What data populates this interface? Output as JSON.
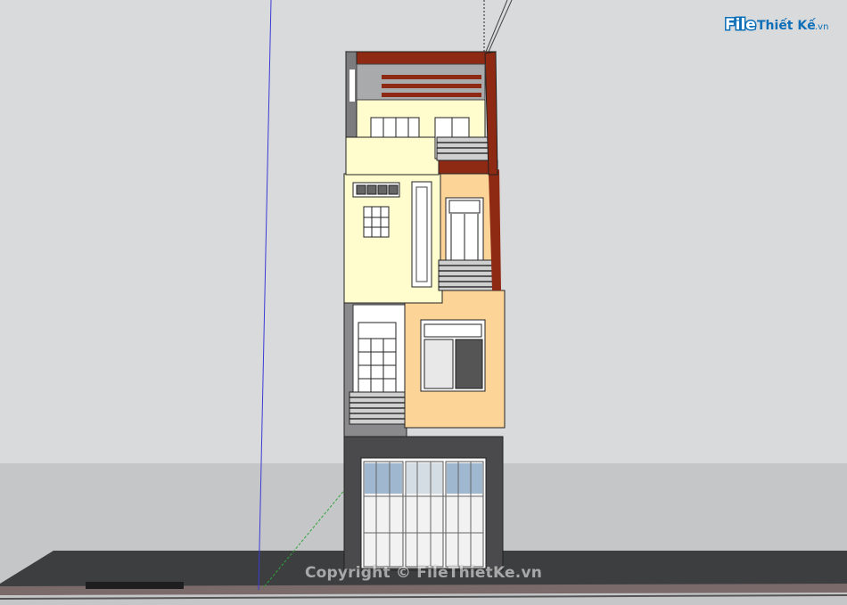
{
  "watermark": {
    "logo_file": "File",
    "logo_rest": "Thiết Kế",
    "logo_suffix": ".vn",
    "copyright": "Copyright © FileThietKe.vn"
  },
  "colors": {
    "sky": "#d9dadc",
    "ground": "#c5c6c8",
    "street": "#3d3e40",
    "wall_cream": "#fffccd",
    "wall_orange": "#fcd498",
    "wall_dark": "#4a4a4c",
    "roof_brown": "#8e2a14",
    "axis_blue": "#3b3bd6",
    "axis_green": "#2fa33a"
  },
  "icons": [
    "facade-window",
    "balcony-railing",
    "folding-door",
    "roof-pergola"
  ]
}
